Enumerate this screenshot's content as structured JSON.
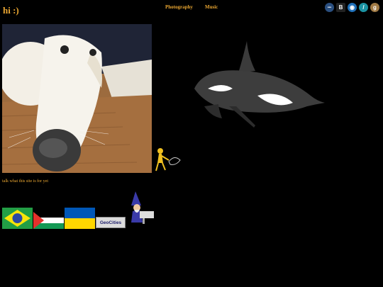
{
  "header": {
    "title": "hi :)"
  },
  "nav": {
    "items": [
      {
        "label": "Photography"
      },
      {
        "label": "Music"
      }
    ]
  },
  "social": {
    "icons": [
      {
        "name": "dots-icon",
        "glyph": "•••",
        "color": "#2a4f80"
      },
      {
        "name": "b-icon",
        "glyph": "B",
        "color": "#222"
      },
      {
        "name": "globe-icon",
        "glyph": "◉",
        "color": "#1e6fb8"
      },
      {
        "name": "slash-icon",
        "glyph": "/",
        "color": "#1b93a3"
      },
      {
        "name": "g-icon",
        "glyph": "g",
        "color": "#a07a45"
      }
    ]
  },
  "main": {
    "caption": "talk what this site is for yet"
  },
  "badges": {
    "geocities_label": "GeoCities"
  },
  "colors": {
    "accent": "#e8a531",
    "background": "#000000"
  }
}
